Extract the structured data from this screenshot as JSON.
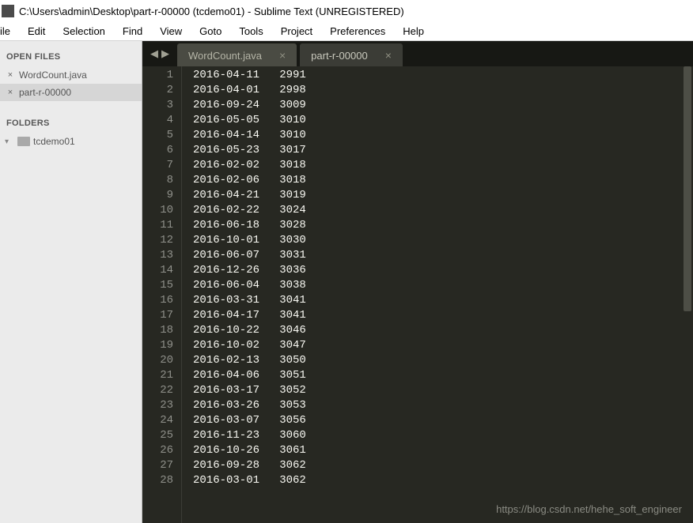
{
  "title": "C:\\Users\\admin\\Desktop\\part-r-00000 (tcdemo01) - Sublime Text (UNREGISTERED)",
  "menu": [
    "ile",
    "Edit",
    "Selection",
    "Find",
    "View",
    "Goto",
    "Tools",
    "Project",
    "Preferences",
    "Help"
  ],
  "sidebar": {
    "open_files_header": "OPEN FILES",
    "open_files": [
      {
        "name": "WordCount.java",
        "active": false
      },
      {
        "name": "part-r-00000",
        "active": true
      }
    ],
    "folders_header": "FOLDERS",
    "folders": [
      {
        "name": "tcdemo01"
      }
    ]
  },
  "tabs": [
    {
      "name": "WordCount.java",
      "active": false
    },
    {
      "name": "part-r-00000",
      "active": true
    }
  ],
  "lines": [
    {
      "n": 1,
      "a": "2016-04-11",
      "b": "2991"
    },
    {
      "n": 2,
      "a": "2016-04-01",
      "b": "2998"
    },
    {
      "n": 3,
      "a": "2016-09-24",
      "b": "3009"
    },
    {
      "n": 4,
      "a": "2016-05-05",
      "b": "3010"
    },
    {
      "n": 5,
      "a": "2016-04-14",
      "b": "3010"
    },
    {
      "n": 6,
      "a": "2016-05-23",
      "b": "3017"
    },
    {
      "n": 7,
      "a": "2016-02-02",
      "b": "3018"
    },
    {
      "n": 8,
      "a": "2016-02-06",
      "b": "3018"
    },
    {
      "n": 9,
      "a": "2016-04-21",
      "b": "3019"
    },
    {
      "n": 10,
      "a": "2016-02-22",
      "b": "3024"
    },
    {
      "n": 11,
      "a": "2016-06-18",
      "b": "3028"
    },
    {
      "n": 12,
      "a": "2016-10-01",
      "b": "3030"
    },
    {
      "n": 13,
      "a": "2016-06-07",
      "b": "3031"
    },
    {
      "n": 14,
      "a": "2016-12-26",
      "b": "3036"
    },
    {
      "n": 15,
      "a": "2016-06-04",
      "b": "3038"
    },
    {
      "n": 16,
      "a": "2016-03-31",
      "b": "3041"
    },
    {
      "n": 17,
      "a": "2016-04-17",
      "b": "3041"
    },
    {
      "n": 18,
      "a": "2016-10-22",
      "b": "3046"
    },
    {
      "n": 19,
      "a": "2016-10-02",
      "b": "3047"
    },
    {
      "n": 20,
      "a": "2016-02-13",
      "b": "3050"
    },
    {
      "n": 21,
      "a": "2016-04-06",
      "b": "3051"
    },
    {
      "n": 22,
      "a": "2016-03-17",
      "b": "3052"
    },
    {
      "n": 23,
      "a": "2016-03-26",
      "b": "3053"
    },
    {
      "n": 24,
      "a": "2016-03-07",
      "b": "3056"
    },
    {
      "n": 25,
      "a": "2016-11-23",
      "b": "3060"
    },
    {
      "n": 26,
      "a": "2016-10-26",
      "b": "3061"
    },
    {
      "n": 27,
      "a": "2016-09-28",
      "b": "3062"
    },
    {
      "n": 28,
      "a": "2016-03-01",
      "b": "3062"
    }
  ],
  "watermark": "https://blog.csdn.net/hehe_soft_engineer"
}
